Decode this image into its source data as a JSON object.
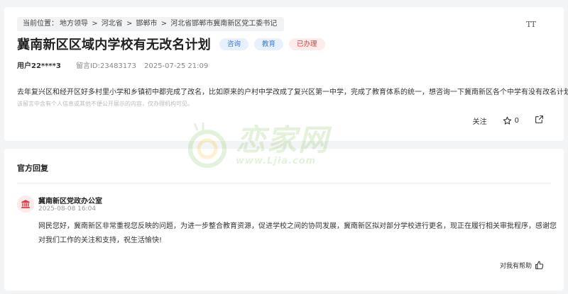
{
  "breadcrumb": {
    "prefix": "当前位置：",
    "items": [
      "地方领导",
      "河北省",
      "邯郸市",
      "河北省邯郸市冀南新区党工委书记"
    ],
    "separator": ">"
  },
  "font_size_button": "TT",
  "message": {
    "title": "冀南新区区域内学校有无改名计划",
    "tags": [
      "咨询",
      "教育",
      "已办理"
    ],
    "user": "用户22****3",
    "id_text": "留言ID:23483173",
    "time": "2025-07-25 21:09",
    "content": "去年复兴区和经开区好多村里小学和乡镇初中都完成了改名，比如原来的户村中学改成了复兴区第一中学，完成了教育体系的统一，想咨询一下冀南新区各个中学有没有改名计划?",
    "note": "该留言中含有个人信息或其他不便公开展示的内容，仅办理机构可见。",
    "follow_label": "关注",
    "star_count": "0"
  },
  "reply": {
    "section_title": "官方回复",
    "office": "冀南新区党政办公室",
    "time": "2025-08-08 16:04",
    "text": "网民您好，冀南新区非常重视您反映的问题，为进一步整合教育资源，促进学校之间的协同发展，冀南新区拟对部分学校进行更名，现正在履行相关审批程序，感谢您对我们工作的关注和支持，祝生活愉快!",
    "helpful_label": "对我有帮助"
  },
  "watermark": {
    "brand": "恋家网",
    "url": "www.Ljia.com"
  },
  "colors": {
    "tag_blue": "#3a7bd5",
    "tag_red": "#e0393e",
    "watermark_green": "#6cb33f"
  }
}
